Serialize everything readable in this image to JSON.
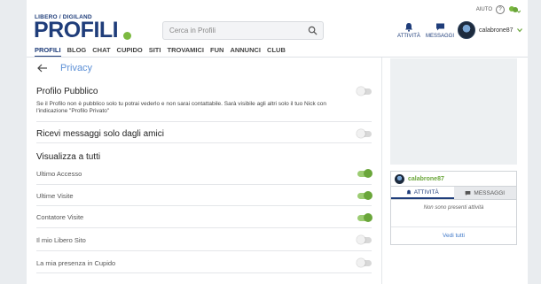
{
  "brand": {
    "subtitle": "LIBERO / DIGILAND",
    "name": "PROFILI"
  },
  "search": {
    "placeholder": "Cerca in Profili"
  },
  "nav": [
    "PROFILI",
    "BLOG",
    "CHAT",
    "CUPIDO",
    "SITI",
    "TROVAMICI",
    "FUN",
    "ANNUNCI",
    "CLUB"
  ],
  "topbar": {
    "help": "AIUTO",
    "help_symbol": "?"
  },
  "header_actions": {
    "activity": "ATTIVITÀ",
    "messages": "MESSAGGI"
  },
  "user": {
    "name": "calabrone87"
  },
  "page": {
    "title": "Privacy"
  },
  "settings": {
    "public_profile": {
      "title": "Profilo Pubblico",
      "desc": "Se il Profilo non è pubblico solo tu potrai vederlo e non sarai contattabile. Sarà visibile agli altri solo il tuo Nick con l'indicazione \"Profilo Privato\"",
      "on": false
    },
    "friends_only": {
      "title": "Ricevi messaggi solo dagli amici",
      "on": false
    },
    "visibility_section": "Visualizza a tutti",
    "items": [
      {
        "label": "Ultimo Accesso",
        "on": true
      },
      {
        "label": "Ultime Visite",
        "on": true
      },
      {
        "label": "Contatore Visite",
        "on": true
      },
      {
        "label": "Il mio Libero Sito",
        "on": false
      },
      {
        "label": "La mia presenza in Cupido",
        "on": false
      }
    ]
  },
  "widget": {
    "user": "calabrone87",
    "tab_activity": "ATTIVITÀ",
    "tab_messages": "MESSAGGI",
    "empty": "Non sono presenti attività",
    "link": "Vedi tutti"
  },
  "colors": {
    "brand": "#1f3d7a",
    "accent_green": "#6aa63a",
    "link": "#5b8fd6"
  }
}
